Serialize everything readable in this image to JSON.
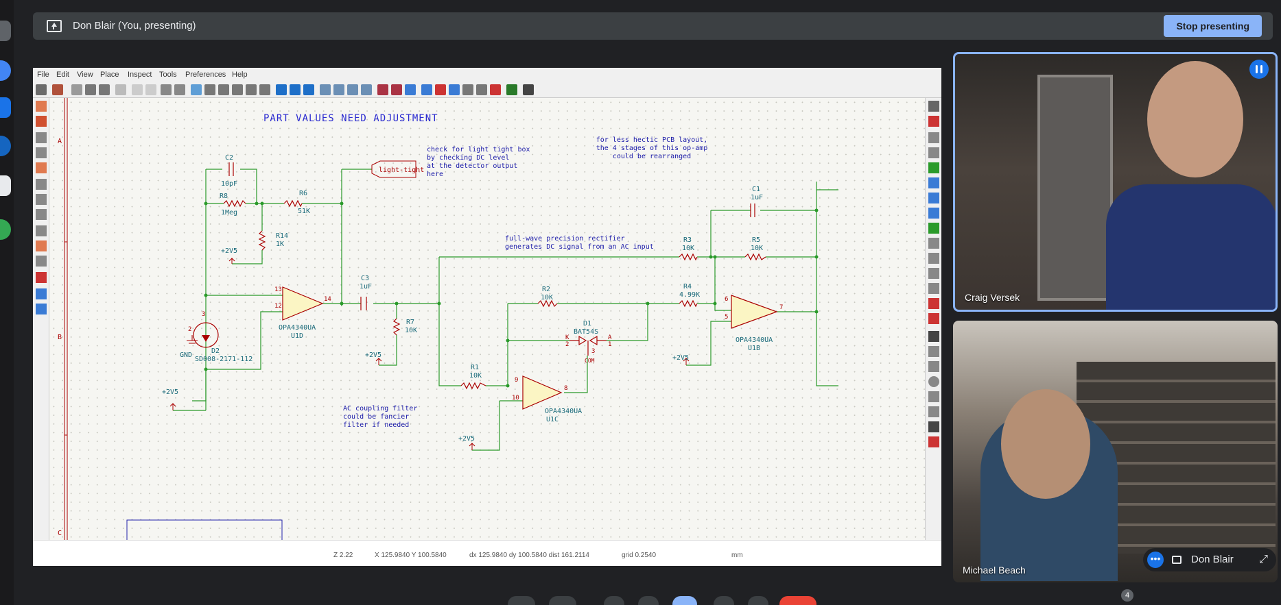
{
  "meet": {
    "presenting_banner": "Don Blair (You, presenting)",
    "stop_button": "Stop presenting",
    "participants": [
      {
        "name": "Craig Versek"
      },
      {
        "name": "Michael Beach"
      }
    ],
    "self_view_name": "Don Blair",
    "people_count": "4",
    "colors": {
      "accent": "#8ab4f8",
      "background": "#202124"
    }
  },
  "kicad": {
    "menu": [
      "File",
      "Edit",
      "View",
      "Place",
      "Inspect",
      "Tools",
      "Preferences",
      "Help"
    ],
    "status": {
      "zoom": "Z 2.22",
      "xy": "X 125.9840  Y 100.5840",
      "dxdy": "dx 125.9840  dy 100.5840  dist 161.2114",
      "grid": "grid 0.2540",
      "units": "mm"
    },
    "border_rows": [
      "A",
      "B",
      "C"
    ],
    "notes": {
      "title": "PART VALUES NEED ADJUSTMENT",
      "light_tight": [
        "check for light tight box",
        "by checking DC level",
        "at the detector output",
        "here"
      ],
      "pcb_layout": [
        "for less hectic PCB layout,",
        "the 4 stages of this op-amp",
        "could be rearranged"
      ],
      "rectifier": [
        "full-wave precision rectifier",
        "generates DC signal from an AC input"
      ],
      "ac_filter": [
        "AC coupling filter",
        "could be fancier",
        "filter if needed"
      ]
    },
    "global_label": "light-tight",
    "components": {
      "C2": {
        "ref": "C2",
        "val": "10pF"
      },
      "R8": {
        "ref": "R8",
        "val": "1Meg"
      },
      "R6": {
        "ref": "R6",
        "val": "51K"
      },
      "R14": {
        "ref": "R14",
        "val": "1K"
      },
      "C3": {
        "ref": "C3",
        "val": "1uF"
      },
      "R7": {
        "ref": "R7",
        "val": "10K"
      },
      "U1D": {
        "ref": "U1D",
        "val": "OPA4340UA"
      },
      "D2": {
        "ref": "D2",
        "val": "SD008-2171-112"
      },
      "R2": {
        "ref": "R2",
        "val": "10K"
      },
      "D1": {
        "ref": "D1",
        "val": "BAT54S"
      },
      "R1": {
        "ref": "R1",
        "val": "10K"
      },
      "U1C": {
        "ref": "U1C",
        "val": "OPA4340UA"
      },
      "R3": {
        "ref": "R3",
        "val": "10K"
      },
      "R5": {
        "ref": "R5",
        "val": "10K"
      },
      "R4": {
        "ref": "R4",
        "val": "4.99K"
      },
      "C1": {
        "ref": "C1",
        "val": "1uF"
      },
      "U1B": {
        "ref": "U1B",
        "val": "OPA4340UA"
      }
    },
    "power": {
      "v": "+2V5",
      "gnd": "GND"
    },
    "pins": {
      "p13": "13",
      "p12": "12",
      "p14": "14",
      "p9": "9",
      "p10": "10",
      "p8": "8",
      "p6": "6",
      "p5": "5",
      "p7": "7",
      "p2": "2",
      "p3": "3",
      "pK": "K",
      "pA": "A",
      "p1": "1",
      "pCOM": "COM"
    }
  }
}
